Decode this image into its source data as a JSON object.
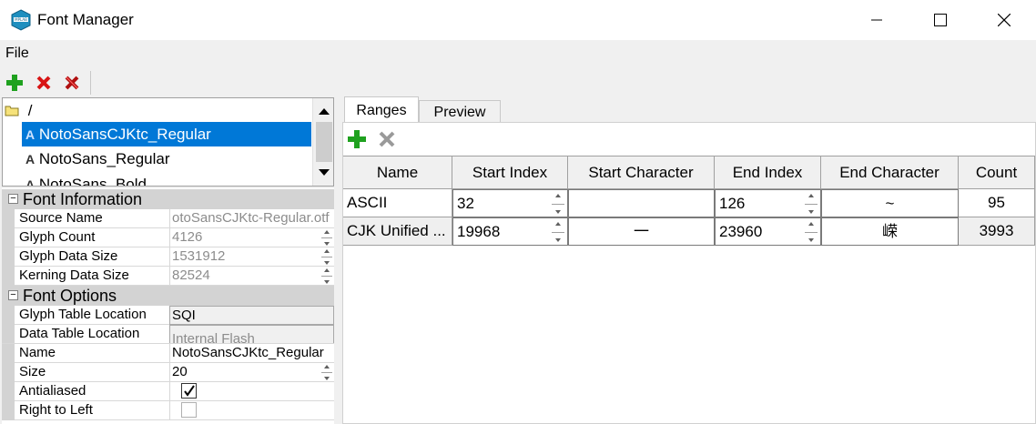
{
  "window": {
    "title": "Font Manager",
    "icon_text": "MPLAB"
  },
  "menu": {
    "file": "File"
  },
  "toolbar": {
    "add": "add-icon",
    "remove": "remove-icon",
    "remove_all": "remove-all-icon"
  },
  "tree": {
    "root": "/",
    "items": [
      {
        "label": "NotoSansCJKtc_Regular",
        "selected": true
      },
      {
        "label": "NotoSans_Regular",
        "selected": false
      },
      {
        "label": "NotoSans_Bold",
        "selected": false
      }
    ]
  },
  "props": {
    "font_information": {
      "label": "Font Information",
      "rows": [
        {
          "name": "Source Name",
          "value": "otoSansCJKtc-Regular.otf"
        },
        {
          "name": "Glyph Count",
          "value": "4126"
        },
        {
          "name": "Glyph Data Size",
          "value": "1531912"
        },
        {
          "name": "Kerning Data Size",
          "value": "82524"
        }
      ]
    },
    "font_options": {
      "label": "Font Options",
      "rows": [
        {
          "name": "Glyph Table Location",
          "value": "SQI"
        },
        {
          "name": "Data Table Location",
          "value": "Internal Flash"
        },
        {
          "name": "Name",
          "value": "NotoSansCJKtc_Regular"
        },
        {
          "name": "Size",
          "value": "20"
        },
        {
          "name": "Antialiased",
          "value": "checked"
        },
        {
          "name": "Right to Left",
          "value": "unchecked"
        }
      ]
    }
  },
  "tabs": [
    "Ranges",
    "Preview"
  ],
  "ranges": {
    "columns": [
      "Name",
      "Start Index",
      "Start Character",
      "End Index",
      "End Character",
      "Count"
    ],
    "rows": [
      [
        "ASCII",
        "32",
        "",
        "126",
        "~",
        "95"
      ],
      [
        "CJK Unified ...",
        "19968",
        "一",
        "23960",
        "嵘",
        "3993"
      ]
    ]
  },
  "colors": {
    "selection": "#0078d7",
    "add_green": "#1fa11f",
    "remove_red": "#d81414"
  }
}
